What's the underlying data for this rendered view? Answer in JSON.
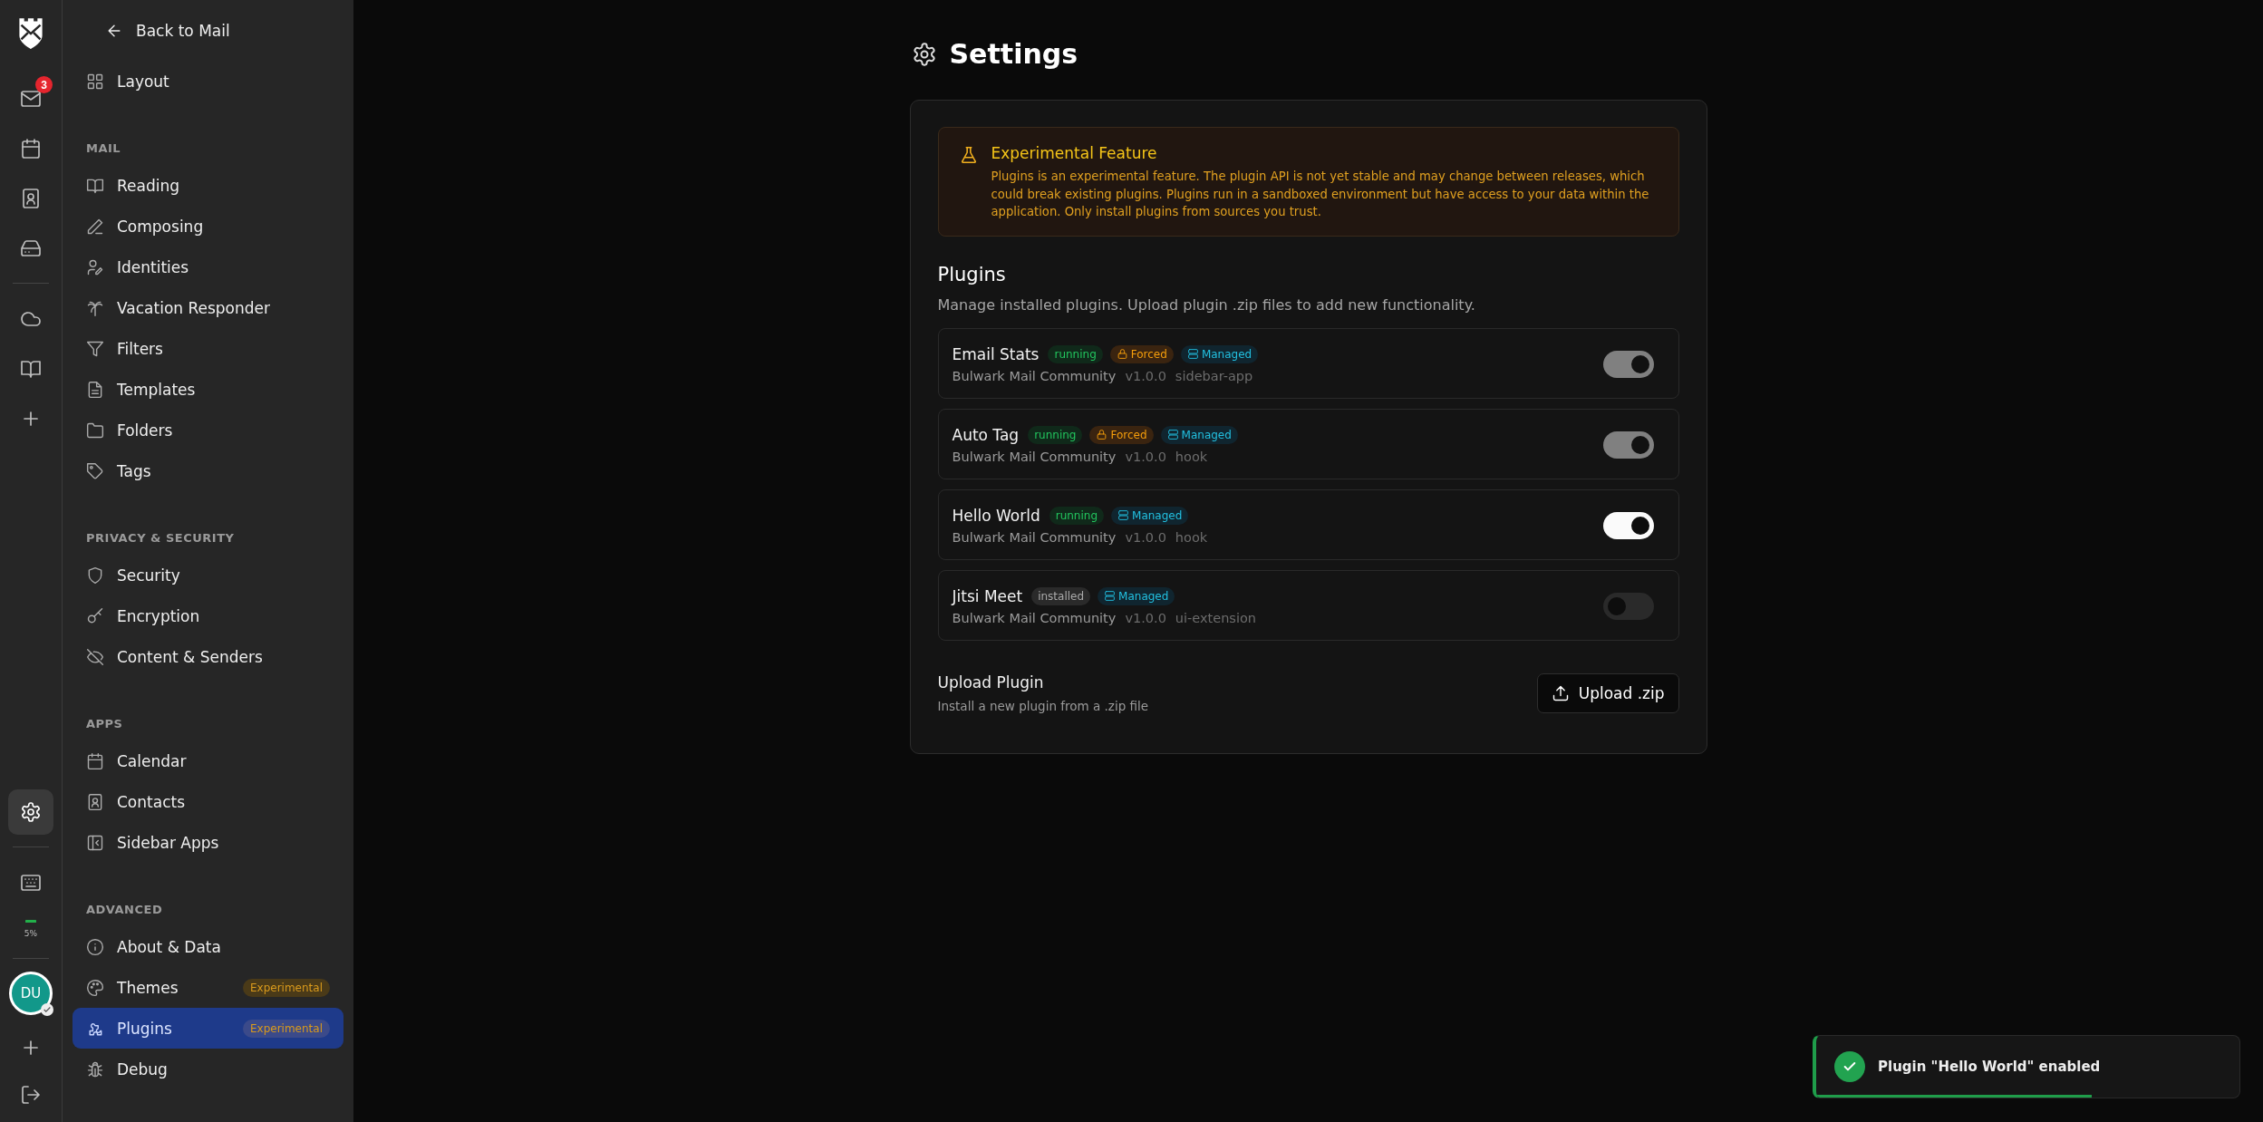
{
  "rail": {
    "apps": [
      {
        "selected": false,
        "badge": "3"
      },
      {
        "selected": false
      },
      {
        "selected": false
      },
      {
        "selected": false
      }
    ],
    "extras": [
      {
        "selected": false
      },
      {
        "selected": false
      }
    ],
    "settings": {
      "selected": true
    },
    "storage": {
      "reading": "5%"
    },
    "avatar": {
      "initials": "DU"
    }
  },
  "sidebar": {
    "back_link": "Back to Mail",
    "sections": [
      {
        "items": [
          {
            "label": "Layout",
            "selected": false
          }
        ]
      },
      {
        "heading": "MAIL",
        "items": [
          {
            "label": "Reading",
            "selected": false
          },
          {
            "label": "Composing",
            "selected": false
          },
          {
            "label": "Identities",
            "selected": false
          },
          {
            "label": "Vacation Responder",
            "selected": false
          },
          {
            "label": "Filters",
            "selected": false
          },
          {
            "label": "Templates",
            "selected": false
          },
          {
            "label": "Folders",
            "selected": false
          },
          {
            "label": "Tags",
            "selected": false
          }
        ]
      },
      {
        "heading": "PRIVACY & SECURITY",
        "items": [
          {
            "label": "Security",
            "selected": false
          },
          {
            "label": "Encryption",
            "selected": false
          },
          {
            "label": "Content & Senders",
            "selected": false
          }
        ]
      },
      {
        "heading": "APPS",
        "items": [
          {
            "label": "Calendar",
            "selected": false
          },
          {
            "label": "Contacts",
            "selected": false
          },
          {
            "label": "Sidebar Apps",
            "selected": false
          }
        ]
      },
      {
        "heading": "ADVANCED",
        "items": [
          {
            "label": "About & Data",
            "selected": false
          },
          {
            "label": "Themes",
            "selected": false,
            "badge": "Experimental"
          },
          {
            "label": "Plugins",
            "selected": true,
            "badge": "Experimental"
          },
          {
            "label": "Debug",
            "selected": false
          }
        ]
      }
    ]
  },
  "page": {
    "title": "Settings"
  },
  "warning": {
    "title": "Experimental Feature",
    "text": "Plugins is an experimental feature. The plugin API is not yet stable and may change between releases, which could break existing plugins. Plugins run in a sandboxed environment but have access to your data within the application. Only install plugins from sources you trust."
  },
  "plugins": {
    "heading": "Plugins",
    "description": "Manage installed plugins. Upload plugin .zip files to add new functionality.",
    "items": [
      {
        "name": "Email Stats",
        "badges": [
          {
            "kind": "running",
            "label": "running"
          },
          {
            "kind": "forced",
            "label": "Forced"
          },
          {
            "kind": "managed",
            "label": "Managed"
          }
        ],
        "author": "Bulwark Mail Community",
        "version": "v1.0.0",
        "type": "sidebar-app",
        "on": true,
        "disabled": true
      },
      {
        "name": "Auto Tag",
        "badges": [
          {
            "kind": "running",
            "label": "running"
          },
          {
            "kind": "forced",
            "label": "Forced"
          },
          {
            "kind": "managed",
            "label": "Managed"
          }
        ],
        "author": "Bulwark Mail Community",
        "version": "v1.0.0",
        "type": "hook",
        "on": true,
        "disabled": true
      },
      {
        "name": "Hello World",
        "badges": [
          {
            "kind": "running",
            "label": "running"
          },
          {
            "kind": "managed",
            "label": "Managed"
          }
        ],
        "author": "Bulwark Mail Community",
        "version": "v1.0.0",
        "type": "hook",
        "on": true,
        "disabled": false
      },
      {
        "name": "Jitsi Meet",
        "badges": [
          {
            "kind": "installed",
            "label": "installed"
          },
          {
            "kind": "managed",
            "label": "Managed"
          }
        ],
        "author": "Bulwark Mail Community",
        "version": "v1.0.0",
        "type": "ui-extension",
        "on": false,
        "disabled": false
      }
    ]
  },
  "upload": {
    "title": "Upload Plugin",
    "description": "Install a new plugin from a .zip file",
    "button": "Upload .zip"
  },
  "toast": {
    "message": "Plugin \"Hello World\" enabled",
    "level": 0.65
  }
}
